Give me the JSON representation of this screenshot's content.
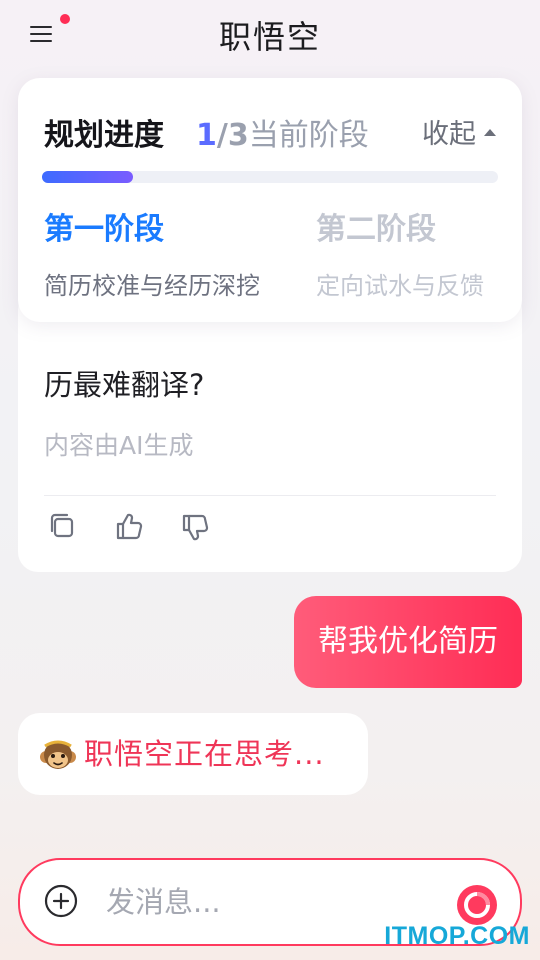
{
  "header": {
    "title": "职悟空",
    "menu_icon": "menu-icon",
    "has_notification_dot": true
  },
  "plan": {
    "title": "规划进度",
    "progress_current": "1",
    "progress_separator": "/",
    "progress_total": "3",
    "progress_suffix": "当前阶段",
    "collapse_label": "收起",
    "progress_fraction": 0.2,
    "stages": [
      {
        "name": "第一阶段",
        "desc": "简历校准与经历深挖",
        "state": "active"
      },
      {
        "name": "第二阶段",
        "desc": "定向试水与反馈",
        "state": "inactive"
      }
    ]
  },
  "chat": {
    "ai_message_visible_text": "历最难翻译?",
    "ai_disclaimer": "内容由AI生成",
    "ai_actions": [
      "copy-icon",
      "thumbs-up-icon",
      "thumbs-down-icon"
    ],
    "user_message": "帮我优化简历",
    "thinking_text": "职悟空正在思考..."
  },
  "input": {
    "placeholder": "发消息..."
  },
  "watermark": "ITMOP.COM",
  "colors": {
    "accent_red": "#ff2d55",
    "accent_blue": "#1a7bff",
    "progress_gradient_start": "#3d6bff",
    "progress_gradient_end": "#7a5cff"
  }
}
